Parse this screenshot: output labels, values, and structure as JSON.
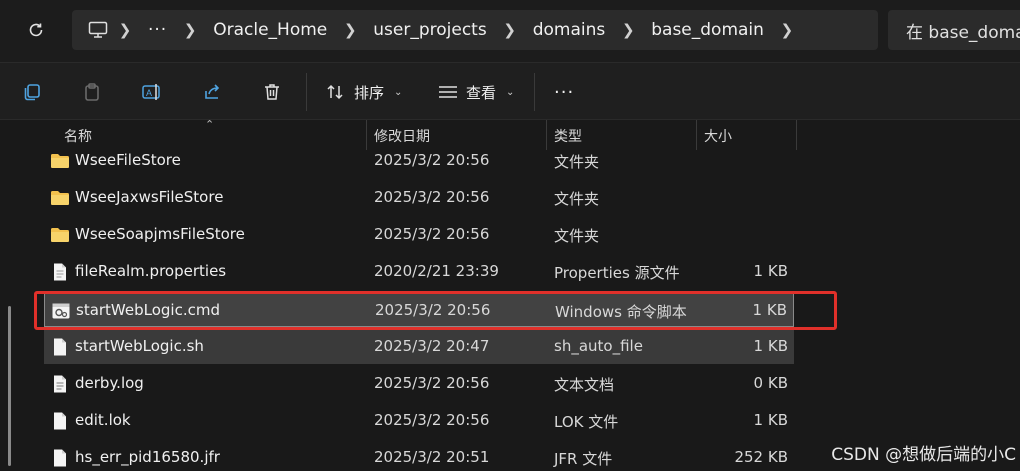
{
  "breadcrumb": {
    "pc_icon": "pc-icon",
    "more": "···",
    "items": [
      "Oracle_Home",
      "user_projects",
      "domains",
      "base_domain"
    ]
  },
  "search": {
    "placeholder": "在 base_domain 中搜索"
  },
  "toolbar": {
    "sort_label": "排序",
    "view_label": "查看",
    "more_label": "···"
  },
  "columns": {
    "name": "名称",
    "date": "修改日期",
    "type": "类型",
    "size": "大小"
  },
  "files": [
    {
      "name": "WseeFileStore",
      "date": "2025/3/2 20:56",
      "type": "文件夹",
      "size": "",
      "icon": "folder-icon"
    },
    {
      "name": "WseeJaxwsFileStore",
      "date": "2025/3/2 20:56",
      "type": "文件夹",
      "size": "",
      "icon": "folder-icon"
    },
    {
      "name": "WseeSoapjmsFileStore",
      "date": "2025/3/2 20:56",
      "type": "文件夹",
      "size": "",
      "icon": "folder-icon"
    },
    {
      "name": "fileRealm.properties",
      "date": "2020/2/21 23:39",
      "type": "Properties 源文件",
      "size": "1 KB",
      "icon": "file-icon"
    },
    {
      "name": "startWebLogic.cmd",
      "date": "2025/3/2 20:56",
      "type": "Windows 命令脚本",
      "size": "1 KB",
      "icon": "cmd-file-icon"
    },
    {
      "name": "startWebLogic.sh",
      "date": "2025/3/2 20:47",
      "type": "sh_auto_file",
      "size": "1 KB",
      "icon": "file-icon"
    },
    {
      "name": "derby.log",
      "date": "2025/3/2 20:56",
      "type": "文本文档",
      "size": "0 KB",
      "icon": "text-file-icon"
    },
    {
      "name": "edit.lok",
      "date": "2025/3/2 20:56",
      "type": "LOK 文件",
      "size": "1 KB",
      "icon": "file-icon"
    },
    {
      "name": "hs_err_pid16580.jfr",
      "date": "2025/3/2 20:51",
      "type": "JFR 文件",
      "size": "252 KB",
      "icon": "file-icon"
    }
  ],
  "watermark": "CSDN @想做后端的小C",
  "colors": {
    "highlight": "#e0302a",
    "folder": "#f2c14e"
  }
}
